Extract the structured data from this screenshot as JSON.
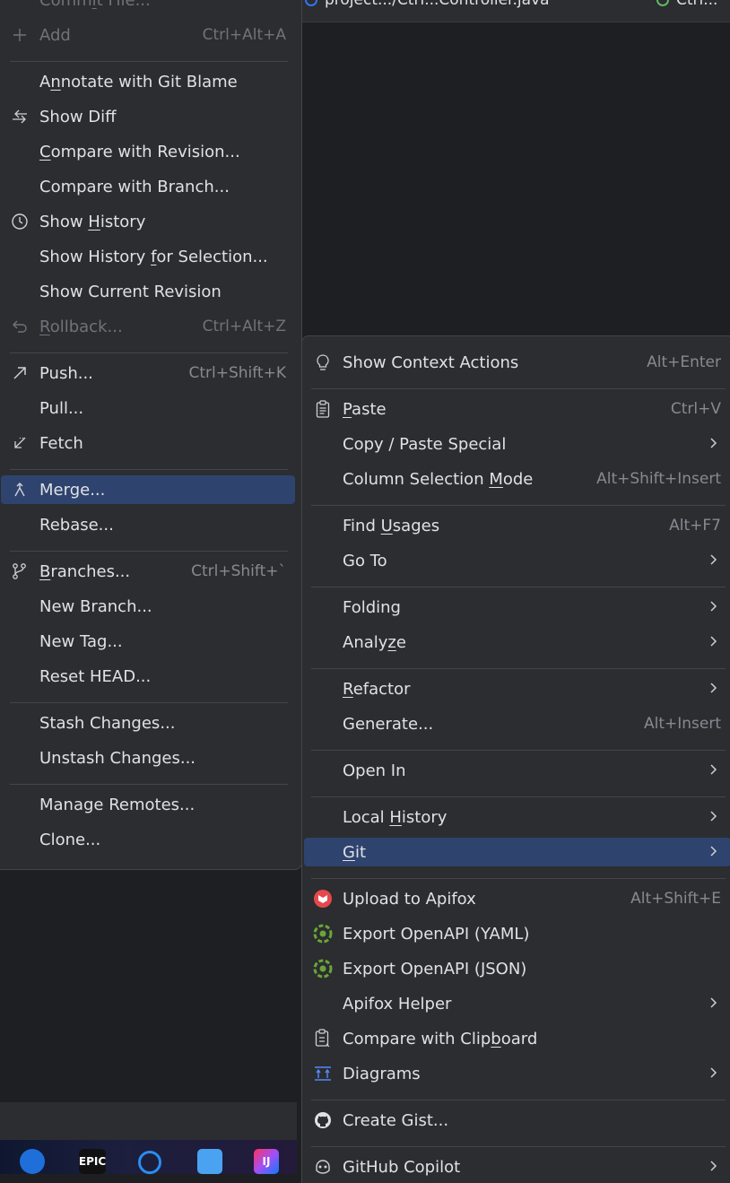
{
  "editor_tabs": [
    {
      "label": "project.../Ctrl...Controller.java"
    },
    {
      "label": "Ctrl..."
    }
  ],
  "git_menu": {
    "items": [
      {
        "id": "commit-file",
        "label": "Commit File...",
        "shortcut": "",
        "icon": "",
        "disabled": true
      },
      {
        "id": "add",
        "label": "Add",
        "shortcut": "Ctrl+Alt+A",
        "icon": "plus-icon",
        "disabled": true
      },
      {
        "sep": true
      },
      {
        "id": "annotate",
        "label": "Annotate with Git Blame",
        "shortcut": "",
        "icon": ""
      },
      {
        "id": "show-diff",
        "label": "Show Diff",
        "shortcut": "",
        "icon": "diff-icon"
      },
      {
        "id": "compare-revision",
        "label": "Compare with Revision...",
        "shortcut": "",
        "icon": ""
      },
      {
        "id": "compare-branch",
        "label": "Compare with Branch...",
        "shortcut": "",
        "icon": ""
      },
      {
        "id": "show-history",
        "label": "Show History",
        "shortcut": "",
        "icon": "clock-icon"
      },
      {
        "id": "history-selection",
        "label": "Show History for Selection...",
        "shortcut": "",
        "icon": ""
      },
      {
        "id": "current-revision",
        "label": "Show Current Revision",
        "shortcut": "",
        "icon": ""
      },
      {
        "id": "rollback",
        "label": "Rollback...",
        "shortcut": "Ctrl+Alt+Z",
        "icon": "undo-icon",
        "disabled": true
      },
      {
        "sep": true
      },
      {
        "id": "push",
        "label": "Push...",
        "shortcut": "Ctrl+Shift+K",
        "icon": "push-arrow-icon"
      },
      {
        "id": "pull",
        "label": "Pull...",
        "shortcut": "",
        "icon": ""
      },
      {
        "id": "fetch",
        "label": "Fetch",
        "shortcut": "",
        "icon": "fetch-arrow-icon"
      },
      {
        "sep": true
      },
      {
        "id": "merge",
        "label": "Merge...",
        "shortcut": "",
        "icon": "merge-icon",
        "selected": true
      },
      {
        "id": "rebase",
        "label": "Rebase...",
        "shortcut": "",
        "icon": ""
      },
      {
        "sep": true
      },
      {
        "id": "branches",
        "label": "Branches...",
        "shortcut": "Ctrl+Shift+`",
        "icon": "branch-icon"
      },
      {
        "id": "new-branch",
        "label": "New Branch...",
        "shortcut": "",
        "icon": ""
      },
      {
        "id": "new-tag",
        "label": "New Tag...",
        "shortcut": "",
        "icon": ""
      },
      {
        "id": "reset-head",
        "label": "Reset HEAD...",
        "shortcut": "",
        "icon": ""
      },
      {
        "sep": true
      },
      {
        "id": "stash",
        "label": "Stash Changes...",
        "shortcut": "",
        "icon": ""
      },
      {
        "id": "unstash",
        "label": "Unstash Changes...",
        "shortcut": "",
        "icon": ""
      },
      {
        "sep": true
      },
      {
        "id": "manage-remotes",
        "label": "Manage Remotes...",
        "shortcut": "",
        "icon": ""
      },
      {
        "id": "clone",
        "label": "Clone...",
        "shortcut": "",
        "icon": ""
      }
    ]
  },
  "context_menu": {
    "items": [
      {
        "id": "context-actions",
        "label": "Show Context Actions",
        "shortcut": "Alt+Enter",
        "icon": "bulb-icon"
      },
      {
        "sep": true
      },
      {
        "id": "paste",
        "label": "Paste",
        "shortcut": "Ctrl+V",
        "icon": "clipboard-icon"
      },
      {
        "id": "copy-paste-special",
        "label": "Copy / Paste Special",
        "shortcut": "",
        "icon": "",
        "submenu": true
      },
      {
        "id": "column-selection",
        "label": "Column Selection Mode",
        "shortcut": "Alt+Shift+Insert",
        "icon": ""
      },
      {
        "sep": true
      },
      {
        "id": "find-usages",
        "label": "Find Usages",
        "shortcut": "Alt+F7",
        "icon": ""
      },
      {
        "id": "go-to",
        "label": "Go To",
        "shortcut": "",
        "icon": "",
        "submenu": true
      },
      {
        "sep": true
      },
      {
        "id": "folding",
        "label": "Folding",
        "shortcut": "",
        "icon": "",
        "submenu": true
      },
      {
        "id": "analyze",
        "label": "Analyze",
        "shortcut": "",
        "icon": "",
        "submenu": true
      },
      {
        "sep": true
      },
      {
        "id": "refactor",
        "label": "Refactor",
        "shortcut": "",
        "icon": "",
        "submenu": true
      },
      {
        "id": "generate",
        "label": "Generate...",
        "shortcut": "Alt+Insert",
        "icon": ""
      },
      {
        "sep": true
      },
      {
        "id": "open-in",
        "label": "Open In",
        "shortcut": "",
        "icon": "",
        "submenu": true
      },
      {
        "sep": true
      },
      {
        "id": "local-history",
        "label": "Local History",
        "shortcut": "",
        "icon": "",
        "submenu": true
      },
      {
        "id": "git",
        "label": "Git",
        "shortcut": "",
        "icon": "",
        "submenu": true,
        "selected": true
      },
      {
        "sep": true
      },
      {
        "id": "upload-apifox",
        "label": "Upload to Apifox",
        "shortcut": "Alt+Shift+E",
        "icon": "apifox-icon"
      },
      {
        "id": "export-yaml",
        "label": "Export OpenAPI (YAML)",
        "shortcut": "",
        "icon": "openapi-icon"
      },
      {
        "id": "export-json",
        "label": "Export OpenAPI (JSON)",
        "shortcut": "",
        "icon": "openapi-icon"
      },
      {
        "id": "apifox-helper",
        "label": "Apifox Helper",
        "shortcut": "",
        "icon": "",
        "submenu": true
      },
      {
        "id": "compare-clipboard",
        "label": "Compare with Clipboard",
        "shortcut": "",
        "icon": "compare-clipboard-icon"
      },
      {
        "id": "diagrams",
        "label": "Diagrams",
        "shortcut": "",
        "icon": "diagram-icon",
        "submenu": true
      },
      {
        "sep": true
      },
      {
        "id": "create-gist",
        "label": "Create Gist...",
        "shortcut": "",
        "icon": "github-icon"
      },
      {
        "sep": true
      },
      {
        "id": "github-copilot",
        "label": "GitHub Copilot",
        "shortcut": "",
        "icon": "copilot-icon",
        "submenu": true
      }
    ]
  },
  "taskbar": {
    "epic_label": "EPIC",
    "ij_label": "IJ"
  },
  "colors": {
    "menu_bg": "#2b2d30",
    "selected_bg": "#2e436e",
    "separator": "#43454a",
    "shortcut_text": "#868a91",
    "apifox_red": "#e5484d",
    "openapi_green": "#6ba539"
  }
}
